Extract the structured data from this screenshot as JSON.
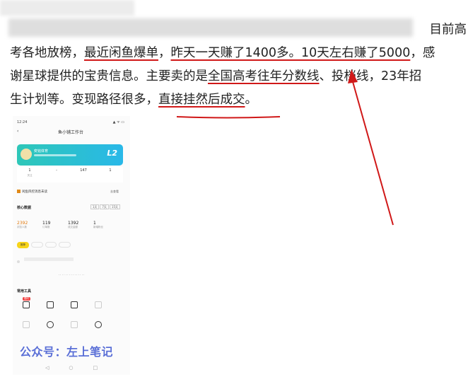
{
  "article": {
    "line1_tail": "目前高",
    "line2": {
      "p1": "考各地放榜，",
      "p2": "最近闲鱼爆单",
      "p3": "，",
      "p4": "昨天一天赚了1400多。10天左右赚了5000",
      "p5": "，感"
    },
    "line3": {
      "p1": "谢星球提供的宝贵信息。主要卖的是",
      "p2": "全国高考往年分数线",
      "p3": "、投档线，23年招"
    },
    "line4": {
      "p1": "生计划等。变现路径很多，",
      "p2": "直接挂然后成交",
      "p3": "。"
    }
  },
  "annotation_color": "#d01818",
  "phone": {
    "status_time": "12:24",
    "status_right": "▲ ᯤ ▭",
    "nav_back": "‹",
    "title": "鱼小铺工作台",
    "card": {
      "name": "奕铭体育",
      "level": "L2"
    },
    "stats": [
      {
        "value": "1",
        "label": "关注"
      },
      {
        "value": "-",
        "label": ""
      },
      {
        "value": "147",
        "label": ""
      },
      {
        "value": "1",
        "label": ""
      }
    ],
    "notice": "闲鱼风控消息未读",
    "notice_btn": "去查看",
    "core": {
      "heading": "核心数据",
      "segments": [
        "1天",
        "7天",
        "15天"
      ],
      "numbers": [
        {
          "value": "2392",
          "label": "浏览人数"
        },
        {
          "value": "119",
          "label": "订单数"
        },
        {
          "value": "1392",
          "label": "成交金额"
        },
        {
          "value": "1",
          "label": "新增粉丝"
        }
      ]
    },
    "chips": [
      "推荐",
      "",
      "",
      ""
    ],
    "tools_heading": "常用工具",
    "tools_badge": "限时",
    "bottom_nav": [
      "◁",
      "○",
      "□"
    ]
  },
  "watermark": "公众号：左上笔记"
}
